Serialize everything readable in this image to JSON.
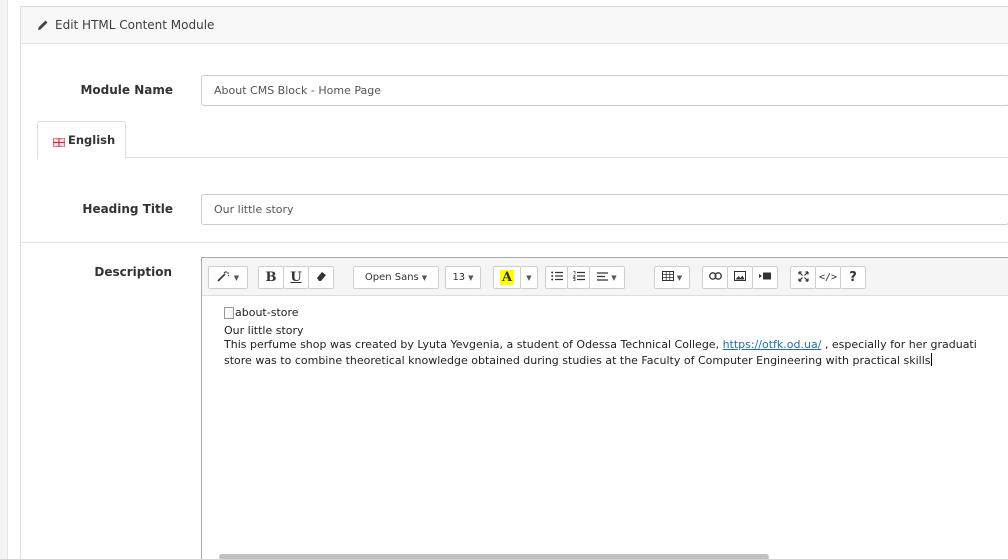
{
  "panel": {
    "title": "Edit HTML Content Module"
  },
  "module_name": {
    "label": "Module Name",
    "value": "About CMS Block - Home Page"
  },
  "tabs": [
    {
      "label": "English"
    }
  ],
  "heading_title": {
    "label": "Heading Title",
    "value": "Our little story"
  },
  "description": {
    "label": "Description",
    "toolbar": {
      "font_family": "Open Sans",
      "font_size": "13",
      "color_letter": "A",
      "bold": "B",
      "underline": "U",
      "code": "</>",
      "help": "?"
    },
    "content": {
      "image_alt": "about-store",
      "heading": "Our little story",
      "p1_before": "This perfume shop was created by Lyuta Yevgenia, a student of Odessa Technical College, ",
      "p1_link": "https://otfk.od.ua/",
      "p1_after": " , especially for her graduati",
      "p2": "store was to combine theoretical knowledge obtained during studies at the Faculty of Computer Engineering with practical skills"
    }
  },
  "colors": {
    "link": "#1f6fb2",
    "highlight": "#ffff00",
    "border": "#cccccc"
  }
}
